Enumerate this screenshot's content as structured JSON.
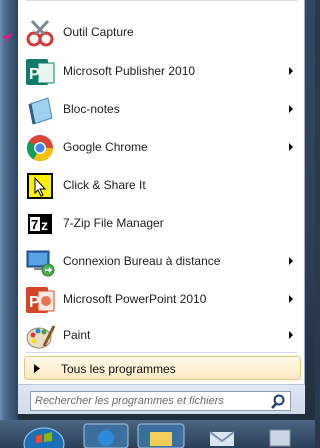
{
  "start_menu": {
    "items": [
      {
        "label": "Outil Capture",
        "icon": "snipping-tool-icon",
        "has_submenu": false
      },
      {
        "label": "Microsoft Publisher 2010",
        "icon": "publisher-icon",
        "has_submenu": true
      },
      {
        "label": "Bloc-notes",
        "icon": "notepad-icon",
        "has_submenu": true
      },
      {
        "label": "Google Chrome",
        "icon": "chrome-icon",
        "has_submenu": true
      },
      {
        "label": "Click & Share It",
        "icon": "click-share-icon",
        "has_submenu": false
      },
      {
        "label": "7-Zip File Manager",
        "icon": "7zip-icon",
        "has_submenu": false
      },
      {
        "label": "Connexion Bureau à distance",
        "icon": "remote-desktop-icon",
        "has_submenu": true
      },
      {
        "label": "Microsoft PowerPoint 2010",
        "icon": "powerpoint-icon",
        "has_submenu": true
      },
      {
        "label": "Paint",
        "icon": "paint-icon",
        "has_submenu": true
      }
    ],
    "all_programs_label": "Tous les programmes",
    "search": {
      "placeholder": "Rechercher les programmes et fichiers",
      "value": ""
    }
  },
  "colors": {
    "highlight_border": "#e8c889",
    "highlight_bg": "#fde9c2",
    "frame": "#2c3e52"
  }
}
